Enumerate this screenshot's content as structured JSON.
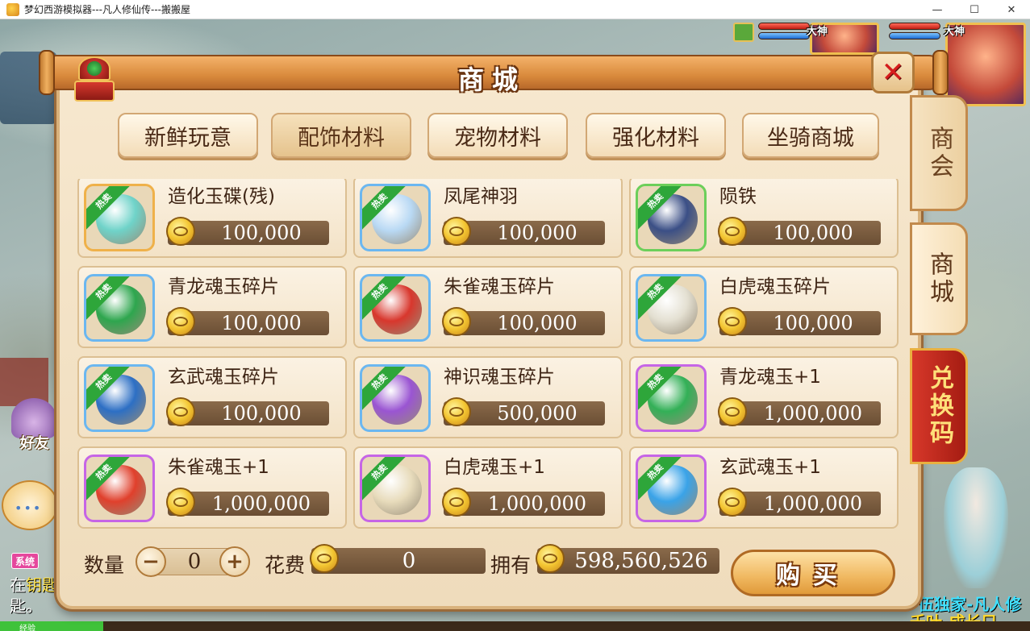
{
  "window": {
    "title": "梦幻西游模拟器---凡人修仙传---搬搬屋",
    "minimize": "—",
    "maximize": "☐",
    "close": "✕"
  },
  "hud": {
    "badge_left": "大神",
    "badge_right": "大神",
    "exp_label": "经验",
    "exp_fraction": 0.1
  },
  "left_side": {
    "friends_label": "好友",
    "chat_dots": "•••",
    "system_badge": "系统",
    "system_line1_a": "在",
    "system_line1_b": "钥匙",
    "system_line2": "匙。"
  },
  "promo": {
    "line1": "伍独家-凡人修",
    "line2": "千叶-成长只",
    "character": "fairy-character"
  },
  "shop": {
    "title": "商城",
    "close_icon": "close-x-icon",
    "categories": [
      {
        "label": "新鲜玩意",
        "active": false
      },
      {
        "label": "配饰材料",
        "active": true
      },
      {
        "label": "宠物材料",
        "active": false
      },
      {
        "label": "强化材料",
        "active": false
      },
      {
        "label": "坐骑商城",
        "active": false
      }
    ],
    "side_tabs": [
      "商会",
      "商城",
      "兑换码"
    ],
    "hot_tag": "热卖",
    "items": [
      {
        "name": "造化玉碟(残)",
        "price": "100,000",
        "frame": "orange",
        "gem": "#6fd3c9"
      },
      {
        "name": "凤尾神羽",
        "price": "100,000",
        "frame": "blue",
        "gem": "#b9d9f4"
      },
      {
        "name": "陨铁",
        "price": "100,000",
        "frame": "green",
        "gem": "#3b4f86"
      },
      {
        "name": "青龙魂玉碎片",
        "price": "100,000",
        "frame": "blue",
        "gem": "#2ea64e"
      },
      {
        "name": "朱雀魂玉碎片",
        "price": "100,000",
        "frame": "blue",
        "gem": "#d8372d"
      },
      {
        "name": "白虎魂玉碎片",
        "price": "100,000",
        "frame": "blue",
        "gem": "#e4e0d2"
      },
      {
        "name": "玄武魂玉碎片",
        "price": "100,000",
        "frame": "blue",
        "gem": "#2d6fc4"
      },
      {
        "name": "神识魂玉碎片",
        "price": "500,000",
        "frame": "blue",
        "gem": "#9a55d2"
      },
      {
        "name": "青龙魂玉+1",
        "price": "1,000,000",
        "frame": "purple",
        "gem": "#33b057"
      },
      {
        "name": "朱雀魂玉+1",
        "price": "1,000,000",
        "frame": "purple",
        "gem": "#e0402c"
      },
      {
        "name": "白虎魂玉+1",
        "price": "1,000,000",
        "frame": "purple",
        "gem": "#e8dcbc"
      },
      {
        "name": "玄武魂玉+1",
        "price": "1,000,000",
        "frame": "purple",
        "gem": "#3aa3e8"
      }
    ],
    "quantity_label": "数量",
    "quantity_value": "0",
    "minus": "−",
    "plus": "+",
    "cost_label": "花费",
    "cost_value": "0",
    "owned_label": "拥有",
    "owned_value": "598,560,526",
    "buy_label": "购买"
  }
}
